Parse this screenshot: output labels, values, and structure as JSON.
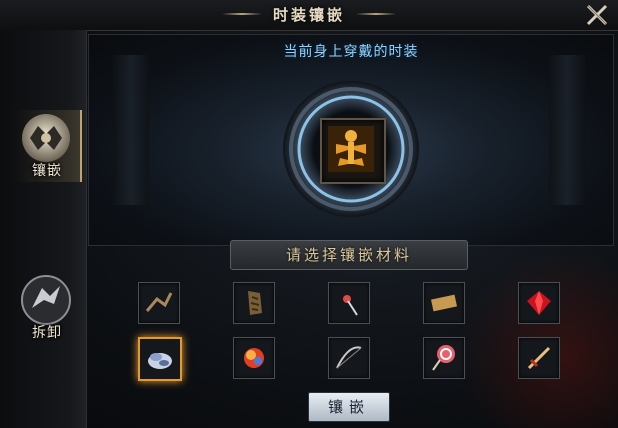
{
  "window": {
    "title": "时装镶嵌"
  },
  "sidebar": {
    "tabs": [
      {
        "label": "镶嵌",
        "active": true
      },
      {
        "label": "拆卸",
        "active": false
      }
    ]
  },
  "scene": {
    "caption": "当前身上穿戴的时装"
  },
  "materials": {
    "banner": "请选择镶嵌材料",
    "items": [
      {
        "icon": "twig-icon",
        "selected": false
      },
      {
        "icon": "bark-icon",
        "selected": false
      },
      {
        "icon": "pin-icon",
        "selected": false
      },
      {
        "icon": "plank-icon",
        "selected": false
      },
      {
        "icon": "red-gem-icon",
        "selected": false
      },
      {
        "icon": "feather-bundle-icon",
        "selected": true
      },
      {
        "icon": "fire-orb-icon",
        "selected": false
      },
      {
        "icon": "bow-icon",
        "selected": false
      },
      {
        "icon": "lollipop-icon",
        "selected": false
      },
      {
        "icon": "sword-icon",
        "selected": false
      }
    ]
  },
  "actions": {
    "inlay_label": "镶嵌"
  },
  "colors": {
    "accent_gold": "#bfa56a",
    "caption_blue": "#8fd3ff",
    "selected_orange": "#e39a2e"
  }
}
